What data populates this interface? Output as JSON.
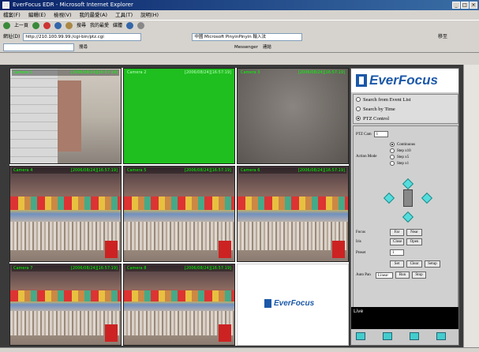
{
  "window": {
    "title": "EverFocus EDR - Microsoft Internet Explorer"
  },
  "menu": [
    "檔案(F)",
    "編輯(E)",
    "檢視(V)",
    "我的最愛(A)",
    "工具(T)",
    "說明(H)"
  ],
  "toolbar": {
    "items": [
      "上一頁",
      "搜尋",
      "我的最愛",
      "媒體"
    ]
  },
  "address": {
    "label": "網址(D)",
    "url": "http://210.100.99.99:/cgi-bin/ptz.cgi",
    "ime": "中國 Microsoft PinyinPinyin 輸入法",
    "go": "移至"
  },
  "links": {
    "items": [
      "搜尋",
      "Messenger",
      "連結"
    ]
  },
  "cameras": [
    {
      "label": "Camera 1",
      "time": "[2006/08/24][16:57:19]",
      "style": "room"
    },
    {
      "label": "Camera 2",
      "time": "[2006/08/24][16:57:19]",
      "style": "green"
    },
    {
      "label": "Camera 3",
      "time": "[2006/08/24][16:57:19]",
      "style": "gray"
    },
    {
      "label": "Camera 4",
      "time": "[2006/08/24][16:57:19]",
      "style": "bazaar"
    },
    {
      "label": "Camera 5",
      "time": "[2006/08/24][16:57:19]",
      "style": "bazaar"
    },
    {
      "label": "Camera 6",
      "time": "[2006/08/24][16:57:19]",
      "style": "bazaar"
    },
    {
      "label": "Camera 7",
      "time": "[2006/08/24][16:57:19]",
      "style": "bazaar"
    },
    {
      "label": "Camera 8",
      "time": "[2006/08/24][16:57:19]",
      "style": "bazaar"
    }
  ],
  "watermark_logo": "EverFocus",
  "panel": {
    "logo": "EverFocus",
    "options": [
      {
        "label": "Search from Event List",
        "checked": false
      },
      {
        "label": "Search by Time",
        "checked": false
      },
      {
        "label": "PTZ Control",
        "checked": true
      }
    ],
    "ptz_cam_label": "PTZ Cam",
    "ptz_cam_value": "1",
    "action_mode_label": "Action Mode",
    "action_modes": [
      "Continuous",
      "Step x10",
      "Step x5",
      "Step x1"
    ],
    "focus_label": "Focus",
    "focus_far": "Far",
    "focus_near": "Near",
    "iris_label": "Iris",
    "iris_close": "Close",
    "iris_open": "Open",
    "preset_label": "Preset",
    "preset_value": "1",
    "set_label": "Set",
    "clear_label": "Clear",
    "setup_label": "Setup",
    "auto_pan_label": "Auto Pan",
    "auto_pan_value": "Linear",
    "run_label": "Run",
    "stop_label": "Stop",
    "live_label": "Live"
  }
}
